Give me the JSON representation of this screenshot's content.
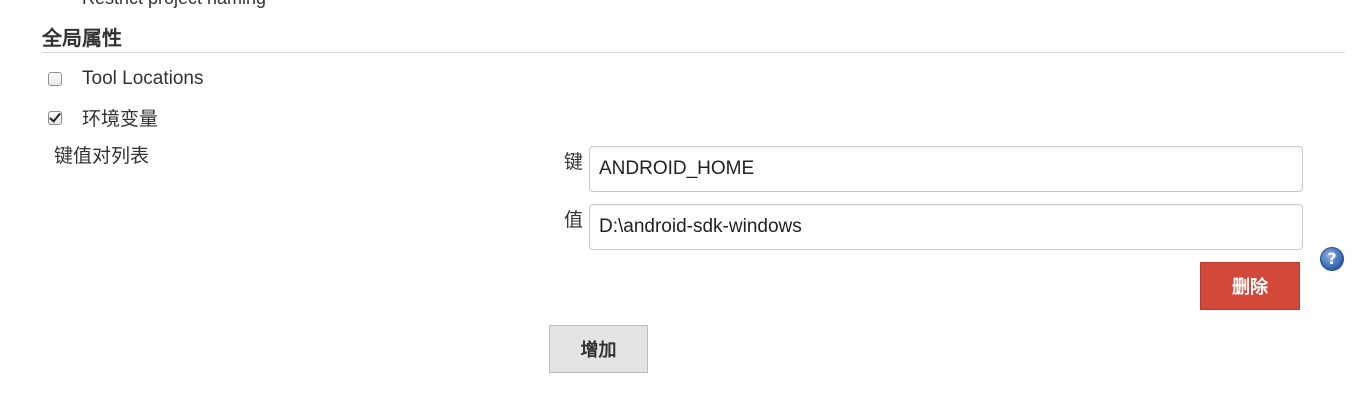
{
  "previous_item": {
    "label": "Restrict project naming"
  },
  "section": {
    "title": "全局属性"
  },
  "options": [
    {
      "label": "Tool Locations",
      "checked": false
    },
    {
      "label": "环境变量",
      "checked": true
    }
  ],
  "env_vars": {
    "list_label": "键值对列表",
    "key_label": "键",
    "key_value": "ANDROID_HOME",
    "value_label": "值",
    "value_value": "D:\\android-sdk-windows",
    "help_icon": "question-icon",
    "help_glyph": "?",
    "delete_label": "删除",
    "add_label": "增加"
  },
  "colors": {
    "delete_button": "#d24939",
    "add_button": "#e4e4e4",
    "help_icon": "#2d5fa8"
  }
}
